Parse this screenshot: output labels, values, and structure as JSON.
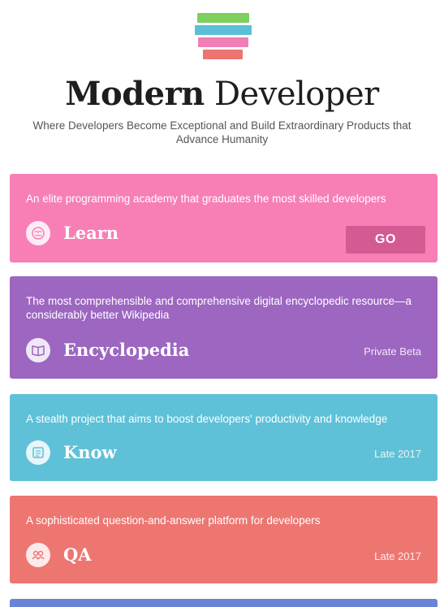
{
  "brand": {
    "name_bold": "Modern",
    "name_light": " Developer",
    "tagline": "Where Developers Become Exceptional and Build Extraordinary Products that Advance Humanity",
    "logo_colors": [
      "#7dcf5e",
      "#5bbfd8",
      "#f07fb6",
      "#ec7471"
    ]
  },
  "cards": {
    "learn": {
      "description": "An elite programming academy that graduates the most skilled developers",
      "name": "Learn",
      "action_label": "GO",
      "icon": "brain-icon",
      "color": "#f77fb6"
    },
    "encyclopedia": {
      "description": "The most comprehensible and comprehensive digital encyclopedic resource—a considerably better Wikipedia",
      "name": "Encyclopedia",
      "status": "Private Beta",
      "icon": "book-icon",
      "color": "#9d66c1"
    },
    "know": {
      "description": "A stealth project that aims to boost developers' productivity and knowledge",
      "name": "Know",
      "status": "Late 2017",
      "icon": "document-icon",
      "color": "#5ec1d8"
    },
    "qa": {
      "description": "A sophisticated question-and-answer platform for developers",
      "name": "QA",
      "status": "Late 2017",
      "icon": "people-icon",
      "color": "#ee7671"
    }
  }
}
